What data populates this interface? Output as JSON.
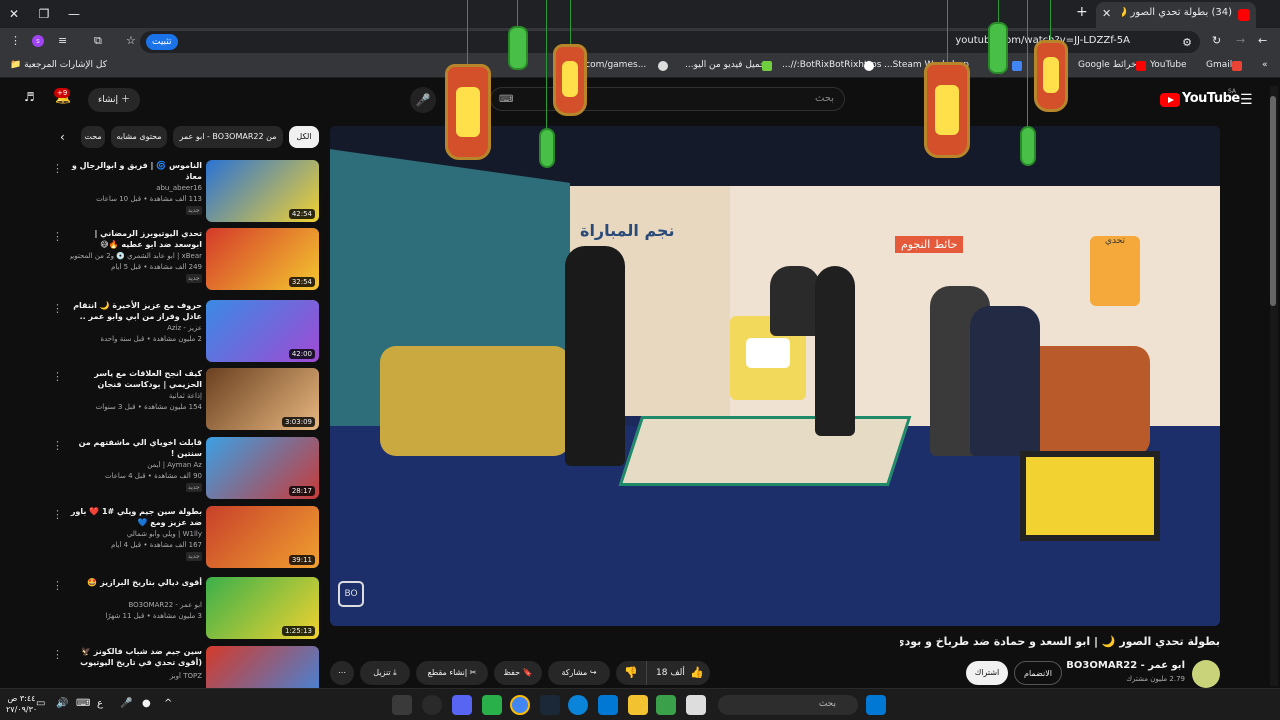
{
  "browser": {
    "tab_title": "(34) بطولة تحدي الصور 🌙 | ابو",
    "url": "youtube.com/watch?v=JJ-LDZZf-5A",
    "pin_label": "تثبيت"
  },
  "bookmarks": {
    "all_bookmarks": "كل الإشارات المرجعية",
    "items": [
      "Gmail",
      "YouTube",
      "خرائط Google",
      "Steam Workshop...",
      "BotRixBotRixhttps://...",
      "تحميل فيديو من اليو...",
      "...tm.com/games/"
    ]
  },
  "header": {
    "logo_text": "YouTube",
    "region": "SA",
    "search_placeholder": "بحث",
    "create_label": "إنشاء",
    "notif_count": "+9"
  },
  "video": {
    "title": "بطولة تحدي الصور 🌙 | ابو السعد و حمادة ضد طرباخ و بودي",
    "channel": "ابو عمر - BO3OMAR22",
    "subscribers": "2.79 مليون مشترك",
    "join_label": "الانضمام",
    "subscribe_label": "اشتراك",
    "likes": "18 ألف",
    "share_label": "مشاركة",
    "save_label": "حفظ",
    "clip_label": "إنشاء مقطع",
    "download_label": "تنزيل",
    "overlay_text_1": "نجم المباراة",
    "overlay_text_2": "حائط النجوم",
    "overlay_text_3": "تحدي",
    "watermark": "BO"
  },
  "chips": [
    "الكل",
    "من BO3OMAR22 - ابو عمر",
    "محتوى مشابه",
    "محت"
  ],
  "recommendations": [
    {
      "title": "الناموس 🌀 | فريق و ابوالرجال و معاذ",
      "channel": "abu_abeer16",
      "meta": "113 ألف مشاهدة • قبل 10 ساعات",
      "duration": "42:54",
      "badge": "جديد"
    },
    {
      "title": "تحدي اليوتيوبرز الرمضاني | ابوسعد ضد ابو عطيه 🔥😅",
      "channel": "xBear | ابو عابد الشمري 💿 و2 من المحتوين الآخرين",
      "meta": "249 ألف مشاهدة • قبل 5 أيام",
      "duration": "32:54",
      "badge": "جديد"
    },
    {
      "title": "حروف مع عزيز الأخيرة 🌙 انتقام عادل وفراز من ابي وابو عمر .. كسروا الطاولة ..",
      "channel": "عزيز - Aziz",
      "meta": "2 مليون مشاهدة • قبل سنة واحدة",
      "duration": "42:00",
      "badge": ""
    },
    {
      "title": "كيف انجح العلاقات مع ياسر الحزيمي | بودكاست فنجان",
      "channel": "إذاعة ثمانية",
      "meta": "154 مليون مشاهدة • قبل 3 سنوات",
      "duration": "3:03:09",
      "badge": ""
    },
    {
      "title": "قابلت اخوياي الي ماشفتهم من سنتين !",
      "channel": "Ayman Az | أيمن",
      "meta": "90 ألف مشاهدة • قبل 4 ساعات",
      "duration": "28:17",
      "badge": "جديد"
    },
    {
      "title": "بطولة سين جيم ويلي #1 ❤️ باور ضد عزيز ومع 💙",
      "channel": "W1lly | ويلي وأبو شمالي",
      "meta": "167 ألف مشاهدة • قبل 4 أيام",
      "duration": "39:11",
      "badge": "جديد"
    },
    {
      "title": "أقوى ديالي بتاريخ البرازيز 🤩",
      "channel": "ابو عمر - BO3OMAR22",
      "meta": "3 مليون مشاهدة • قبل 11 شهرًا",
      "duration": "1:25:13",
      "badge": ""
    },
    {
      "title": "سين جيم ضد شباب فالكونز 🦅 (أقوى تحدي في تاريخ اليوتيوب 🔥)",
      "channel": "TOPZ أوبز",
      "meta": "",
      "duration": "",
      "badge": ""
    }
  ],
  "taskbar": {
    "search_placeholder": "بحث",
    "time": "٣:٤٤ ص",
    "date": "٢٧/٠٩/٣٠",
    "lang": "ع"
  },
  "colors": {
    "yt_red": "#ff0000",
    "bg": "#0f0f0f",
    "chip": "#272727"
  }
}
